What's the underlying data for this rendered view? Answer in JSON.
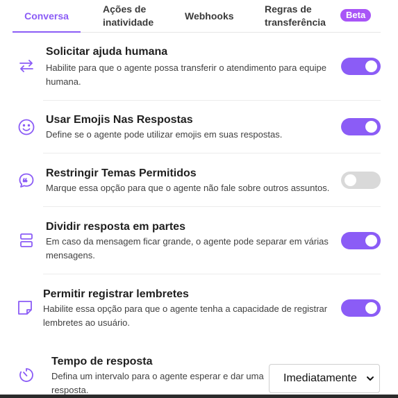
{
  "tabs": [
    {
      "label": "Conversa",
      "active": true
    },
    {
      "label": "Ações de\ninatividade",
      "active": false
    },
    {
      "label": "Webhooks",
      "active": false
    },
    {
      "label": "Regras de\ntransferência",
      "active": false,
      "badge": "Beta"
    }
  ],
  "settings": [
    {
      "icon": "arrows-swap-icon",
      "title": "Solicitar ajuda humana",
      "desc1": "Habilite para que o agente possa transferir o atendimento para equipe",
      "desc2": "humana.",
      "enabled": true
    },
    {
      "icon": "smile-icon",
      "title": "Usar Emojis Nas Respostas",
      "desc1": "Define se o agente pode utilizar emojis em suas respostas.",
      "desc2": "",
      "enabled": true
    },
    {
      "icon": "quote-bubble-icon",
      "title": "Restringir Temas Permitidos",
      "desc1": "Marque essa opção para que o agente não fale sobre outros assuntos.",
      "desc2": "",
      "enabled": false
    },
    {
      "icon": "split-rows-icon",
      "title": "Dividir resposta em partes",
      "desc1": "Em caso da mensagem ficar grande, o agente pode separar em várias",
      "desc2": "mensagens.",
      "enabled": true
    },
    {
      "icon": "sticky-note-icon",
      "title": "Permitir registrar lembretes",
      "desc1": "Habilite essa opção para que o agente tenha a capacidade de registrar",
      "desc2": "lembretes ao usuário.",
      "enabled": true
    },
    {
      "icon": "timer-icon",
      "title": "Tempo de resposta",
      "desc1": "Defina um intervalo para o agente esperar e dar uma",
      "desc2": "resposta.",
      "enabled": null
    }
  ],
  "response_time_select": {
    "value": "Imediatamente"
  },
  "colors": {
    "accent": "#8b5cf6",
    "badge": "#a855f7",
    "toggle_off": "#d9d9d9"
  }
}
